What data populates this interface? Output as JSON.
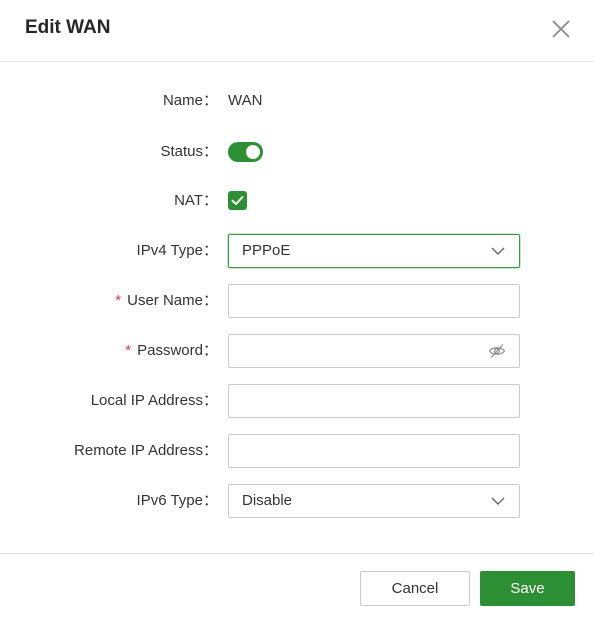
{
  "dialog": {
    "title": "Edit WAN"
  },
  "form": {
    "name_label": "Name",
    "name_value": "WAN",
    "status_label": "Status",
    "status_on": true,
    "nat_label": "NAT",
    "nat_checked": true,
    "ipv4_type_label": "IPv4 Type",
    "ipv4_type_value": "PPPoE",
    "username_label": "User Name",
    "username_value": "",
    "password_label": "Password",
    "password_value": "",
    "local_ip_label": "Local IP Address",
    "local_ip_value": "",
    "remote_ip_label": "Remote IP Address",
    "remote_ip_value": "",
    "ipv6_type_label": "IPv6 Type",
    "ipv6_type_value": "Disable",
    "label_suffix": "：",
    "required_mark": "*"
  },
  "footer": {
    "cancel_label": "Cancel",
    "save_label": "Save"
  },
  "colors": {
    "accent": "#2d8f34",
    "required": "#e0363d"
  },
  "icons": {
    "close": "close-icon",
    "dropdown": "chevron-down-icon",
    "password_toggle": "eye-off-icon",
    "check": "check-icon"
  }
}
